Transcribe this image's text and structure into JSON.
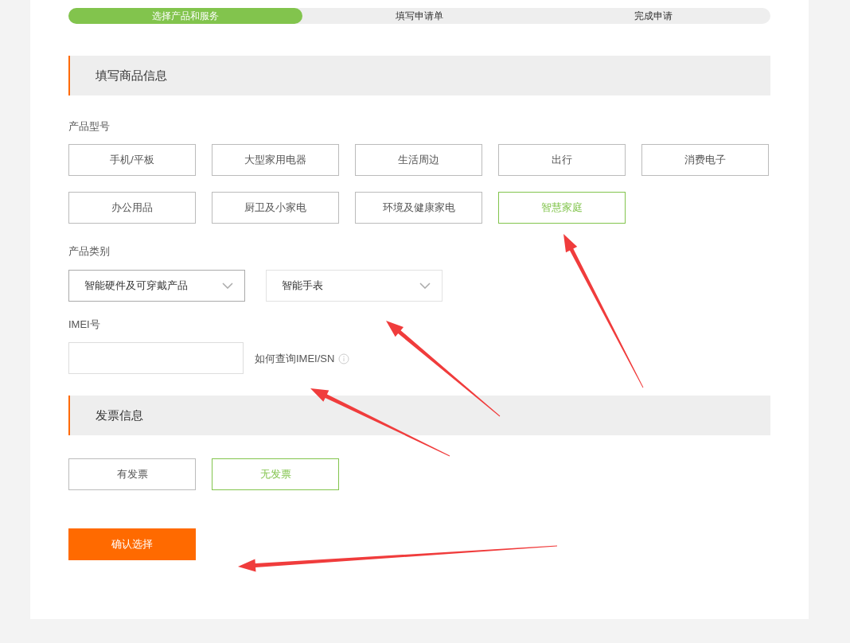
{
  "steps": [
    {
      "label": "选择产品和服务",
      "selected": true
    },
    {
      "label": "填写申请单",
      "selected": false
    },
    {
      "label": "完成申请",
      "selected": false
    }
  ],
  "product_section": {
    "title": "填写商品信息"
  },
  "model": {
    "label": "产品型号",
    "options": [
      {
        "label": "手机/平板",
        "selected": false
      },
      {
        "label": "大型家用电器",
        "selected": false
      },
      {
        "label": "生活周边",
        "selected": false
      },
      {
        "label": "出行",
        "selected": false
      },
      {
        "label": "消费电子",
        "selected": false
      },
      {
        "label": "办公用品",
        "selected": false
      },
      {
        "label": "厨卫及小家电",
        "selected": false
      },
      {
        "label": "环境及健康家电",
        "selected": false
      },
      {
        "label": "智慧家庭",
        "selected": true
      }
    ]
  },
  "category": {
    "label": "产品类别",
    "dropdowns": [
      {
        "value": "智能硬件及可穿戴产品",
        "active": true
      },
      {
        "value": "智能手表",
        "active": false
      }
    ]
  },
  "imei": {
    "label": "IMEI号",
    "help_link": "如何查询IMEI/SN"
  },
  "invoice_section": {
    "title": "发票信息",
    "options": [
      {
        "label": "有发票",
        "selected": false
      },
      {
        "label": "无发票",
        "selected": true
      }
    ]
  },
  "confirm_button": "确认选择"
}
